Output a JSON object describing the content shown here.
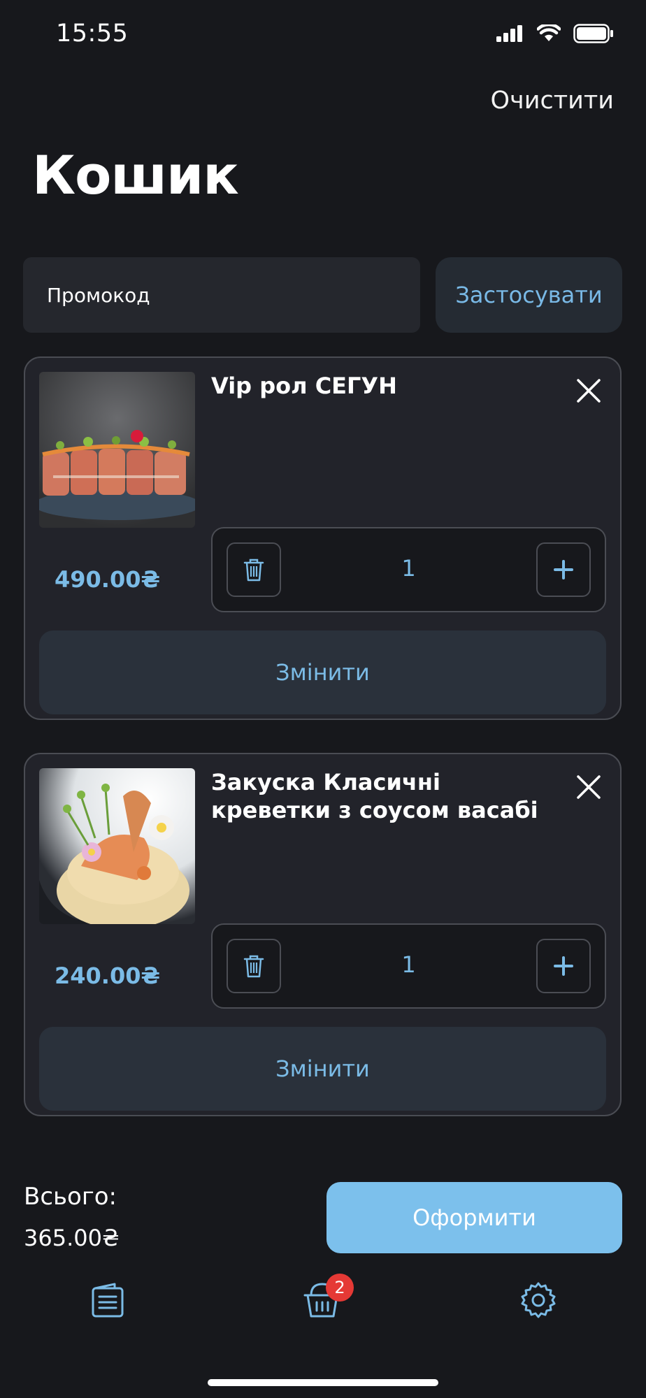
{
  "status_bar": {
    "time": "15:55",
    "icons": [
      "signal-icon",
      "wifi-icon",
      "battery-icon"
    ]
  },
  "header": {
    "clear_label": "Очистити",
    "title": "Кошик"
  },
  "promo": {
    "placeholder": "Промокод",
    "apply_label": "Застосувати"
  },
  "cart_items": [
    {
      "title": "Vip рол СЕГУН",
      "price": "490.00₴",
      "quantity": "1",
      "change_label": "Змінити"
    },
    {
      "title": "Закуска Класичні креветки з соусом васабі",
      "price": "240.00₴",
      "quantity": "1",
      "change_label": "Змінити"
    }
  ],
  "summary": {
    "total_label": "Всього:",
    "total_value": "365.00₴",
    "checkout_label": "Оформити"
  },
  "tab_bar": {
    "tabs": [
      "menu-icon",
      "basket-icon",
      "settings-icon"
    ],
    "basket_badge": "2"
  },
  "colors": {
    "background": "#17181c",
    "card": "#22232a",
    "accent": "#7bbbe6",
    "badge": "#e53935"
  }
}
